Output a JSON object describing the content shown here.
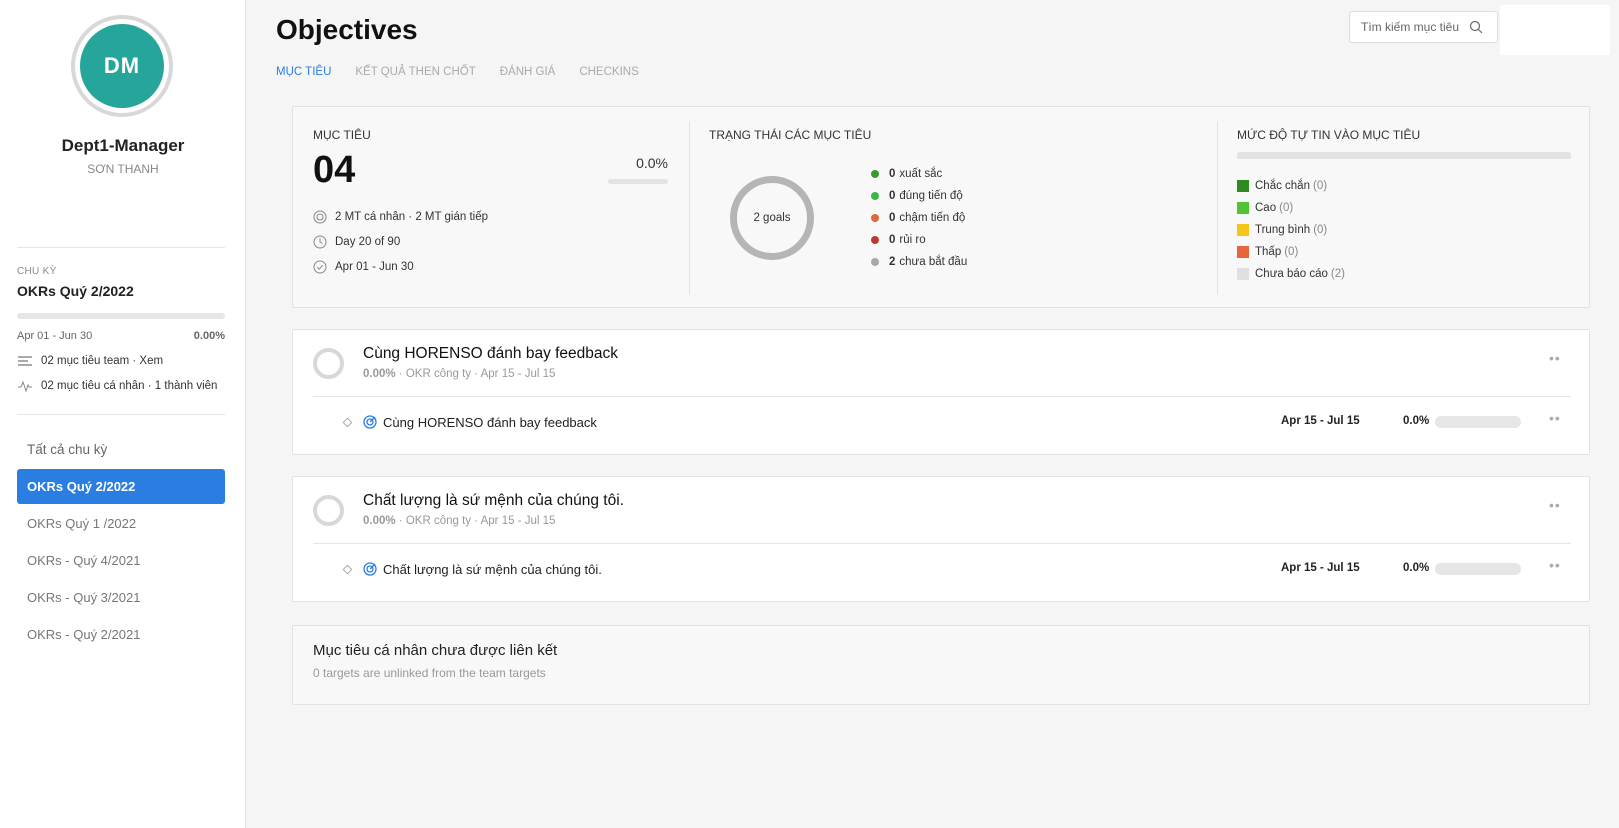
{
  "user": {
    "initials": "DM",
    "name": "Dept1-Manager",
    "subtitle": "SƠN THANH"
  },
  "cycle": {
    "label": "CHU KỲ",
    "name": "OKRs Quý 2/2022",
    "dates": "Apr 01 - Jun 30",
    "progress": "0.00%",
    "progress_value": 0,
    "team_goals": "02 mục tiêu team · Xem",
    "personal_goals": "02 mục tiêu cá nhân · 1 thành viên"
  },
  "cycle_list": {
    "header": "Tất cả chu kỳ",
    "items": [
      "OKRs Quý 2/2022",
      "OKRs Quý 1 /2022",
      "OKRs - Quý 4/2021",
      "OKRs - Quý 3/2021",
      "OKRs - Quý 2/2021"
    ],
    "active_index": 0
  },
  "page": {
    "title": "Objectives"
  },
  "tabs": [
    "MỤC TIÊU",
    "KẾT QUẢ THEN CHỐT",
    "ĐÁNH GIÁ",
    "CHECKINS"
  ],
  "search": {
    "placeholder": "Tìm kiếm mục tiêu"
  },
  "summary": {
    "objectives_header": "MỤC TIÊU",
    "count": "04",
    "percent": "0.0%",
    "breakdown": "2 MT cá nhân · 2 MT gián tiếp",
    "day": "Day 20 of 90",
    "dates": "Apr 01 - Jun 30",
    "status_header": "TRẠNG THÁI CÁC MỤC TIÊU",
    "donut_label": "2 goals",
    "statuses": [
      {
        "count": "0",
        "label": "xuất sắc",
        "color": "#3a9a2f"
      },
      {
        "count": "0",
        "label": "đúng tiến độ",
        "color": "#3ab54a"
      },
      {
        "count": "0",
        "label": "chậm tiến độ",
        "color": "#e5663a"
      },
      {
        "count": "0",
        "label": "rủi ro",
        "color": "#c0392b"
      },
      {
        "count": "2",
        "label": "chưa bắt đầu",
        "color": "#a8a8a8"
      }
    ],
    "confidence_header": "MỨC ĐỘ TỰ TIN VÀO MỤC TIÊU",
    "confidence": [
      {
        "label": "Chắc chắn",
        "count": "(0)",
        "color": "#2e8b22"
      },
      {
        "label": "Cao",
        "count": "(0)",
        "color": "#52c234"
      },
      {
        "label": "Trung bình",
        "count": "(0)",
        "color": "#f5c518"
      },
      {
        "label": "Thấp",
        "count": "(0)",
        "color": "#e5663a"
      },
      {
        "label": "Chưa báo cáo",
        "count": "(2)",
        "color": "#e0e0e0"
      }
    ]
  },
  "objectives": [
    {
      "title": "Cùng HORENSO đánh bay feedback",
      "percent": "0.00%",
      "meta": " · OKR công ty · Apr 15 - Jul 15",
      "kr": {
        "title": "Cùng HORENSO đánh bay feedback",
        "dates": "Apr 15 - Jul 15",
        "percent": "0.0%",
        "progress": 0
      }
    },
    {
      "title": "Chất lượng là sứ mệnh của chúng tôi.",
      "percent": "0.00%",
      "meta": " · OKR công ty · Apr 15 - Jul 15",
      "kr": {
        "title": "Chất lượng là sứ mệnh của chúng tôi.",
        "dates": "Apr 15 - Jul 15",
        "percent": "0.0%",
        "progress": 0
      }
    }
  ],
  "unlinked": {
    "title": "Mục tiêu cá nhân chưa được liên kết",
    "subtitle": "0 targets are unlinked from the team targets"
  },
  "colors": {
    "accent": "#2a7de1",
    "avatar": "#26a69a"
  }
}
